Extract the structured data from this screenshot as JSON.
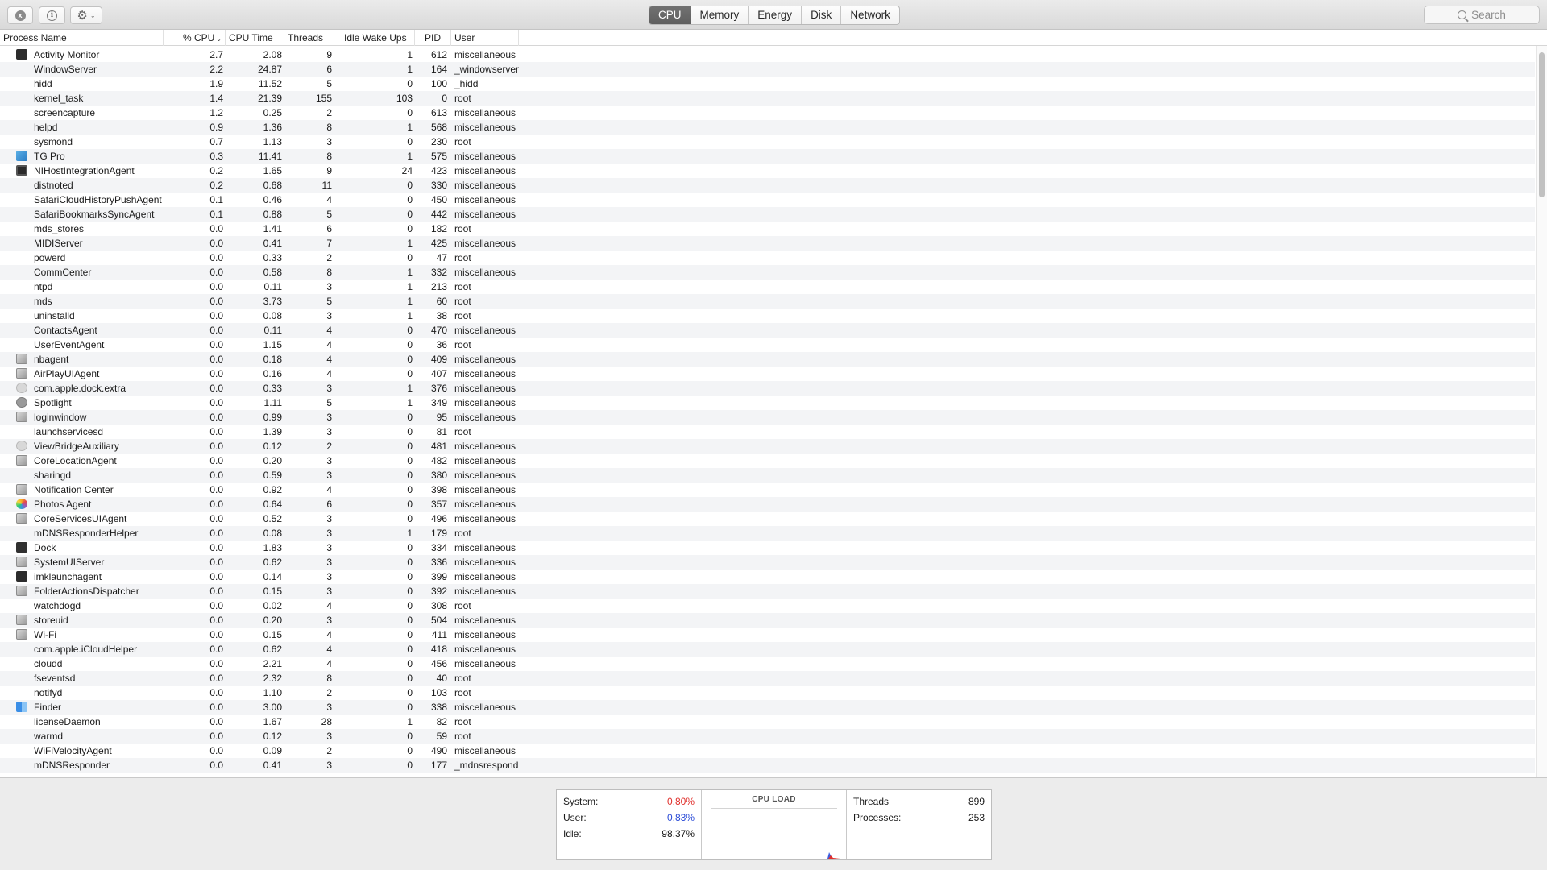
{
  "toolbar": {
    "close_icon": "x",
    "info_icon": "i",
    "gear_icon": "⚙",
    "chevron": "⌄",
    "tabs": [
      "CPU",
      "Memory",
      "Energy",
      "Disk",
      "Network"
    ],
    "active_tab": "CPU",
    "search_placeholder": "Search"
  },
  "columns": {
    "process_name": "Process Name",
    "cpu": "% CPU",
    "cpu_time": "CPU Time",
    "threads": "Threads",
    "idle_wake_ups": "Idle Wake Ups",
    "pid": "PID",
    "user": "User",
    "sort_indicator": "⌄"
  },
  "processes": [
    {
      "name": "Activity Monitor",
      "cpu": "2.7",
      "time": "2.08",
      "threads": "9",
      "idle": "1",
      "pid": "612",
      "user": "miscellaneous",
      "icon": "terminal"
    },
    {
      "name": "WindowServer",
      "cpu": "2.2",
      "time": "24.87",
      "threads": "6",
      "idle": "1",
      "pid": "164",
      "user": "_windowserver",
      "icon": ""
    },
    {
      "name": "hidd",
      "cpu": "1.9",
      "time": "11.52",
      "threads": "5",
      "idle": "0",
      "pid": "100",
      "user": "_hidd",
      "icon": ""
    },
    {
      "name": "kernel_task",
      "cpu": "1.4",
      "time": "21.39",
      "threads": "155",
      "idle": "103",
      "pid": "0",
      "user": "root",
      "icon": ""
    },
    {
      "name": "screencapture",
      "cpu": "1.2",
      "time": "0.25",
      "threads": "2",
      "idle": "0",
      "pid": "613",
      "user": "miscellaneous",
      "icon": ""
    },
    {
      "name": "helpd",
      "cpu": "0.9",
      "time": "1.36",
      "threads": "8",
      "idle": "1",
      "pid": "568",
      "user": "miscellaneous",
      "icon": ""
    },
    {
      "name": "sysmond",
      "cpu": "0.7",
      "time": "1.13",
      "threads": "3",
      "idle": "0",
      "pid": "230",
      "user": "root",
      "icon": ""
    },
    {
      "name": "TG Pro",
      "cpu": "0.3",
      "time": "11.41",
      "threads": "8",
      "idle": "1",
      "pid": "575",
      "user": "miscellaneous",
      "icon": "blue"
    },
    {
      "name": "NIHostIntegrationAgent",
      "cpu": "0.2",
      "time": "1.65",
      "threads": "9",
      "idle": "24",
      "pid": "423",
      "user": "miscellaneous",
      "icon": "ni"
    },
    {
      "name": "distnoted",
      "cpu": "0.2",
      "time": "0.68",
      "threads": "11",
      "idle": "0",
      "pid": "330",
      "user": "miscellaneous",
      "icon": ""
    },
    {
      "name": "SafariCloudHistoryPushAgent",
      "cpu": "0.1",
      "time": "0.46",
      "threads": "4",
      "idle": "0",
      "pid": "450",
      "user": "miscellaneous",
      "icon": ""
    },
    {
      "name": "SafariBookmarksSyncAgent",
      "cpu": "0.1",
      "time": "0.88",
      "threads": "5",
      "idle": "0",
      "pid": "442",
      "user": "miscellaneous",
      "icon": ""
    },
    {
      "name": "mds_stores",
      "cpu": "0.0",
      "time": "1.41",
      "threads": "6",
      "idle": "0",
      "pid": "182",
      "user": "root",
      "icon": ""
    },
    {
      "name": "MIDIServer",
      "cpu": "0.0",
      "time": "0.41",
      "threads": "7",
      "idle": "1",
      "pid": "425",
      "user": "miscellaneous",
      "icon": ""
    },
    {
      "name": "powerd",
      "cpu": "0.0",
      "time": "0.33",
      "threads": "2",
      "idle": "0",
      "pid": "47",
      "user": "root",
      "icon": ""
    },
    {
      "name": "CommCenter",
      "cpu": "0.0",
      "time": "0.58",
      "threads": "8",
      "idle": "1",
      "pid": "332",
      "user": "miscellaneous",
      "icon": ""
    },
    {
      "name": "ntpd",
      "cpu": "0.0",
      "time": "0.11",
      "threads": "3",
      "idle": "1",
      "pid": "213",
      "user": "root",
      "icon": ""
    },
    {
      "name": "mds",
      "cpu": "0.0",
      "time": "3.73",
      "threads": "5",
      "idle": "1",
      "pid": "60",
      "user": "root",
      "icon": ""
    },
    {
      "name": "uninstalld",
      "cpu": "0.0",
      "time": "0.08",
      "threads": "3",
      "idle": "1",
      "pid": "38",
      "user": "root",
      "icon": ""
    },
    {
      "name": "ContactsAgent",
      "cpu": "0.0",
      "time": "0.11",
      "threads": "4",
      "idle": "0",
      "pid": "470",
      "user": "miscellaneous",
      "icon": ""
    },
    {
      "name": "UserEventAgent",
      "cpu": "0.0",
      "time": "1.15",
      "threads": "4",
      "idle": "0",
      "pid": "36",
      "user": "root",
      "icon": ""
    },
    {
      "name": "nbagent",
      "cpu": "0.0",
      "time": "0.18",
      "threads": "4",
      "idle": "0",
      "pid": "409",
      "user": "miscellaneous",
      "icon": "gen"
    },
    {
      "name": "AirPlayUIAgent",
      "cpu": "0.0",
      "time": "0.16",
      "threads": "4",
      "idle": "0",
      "pid": "407",
      "user": "miscellaneous",
      "icon": "gen"
    },
    {
      "name": "com.apple.dock.extra",
      "cpu": "0.0",
      "time": "0.33",
      "threads": "3",
      "idle": "1",
      "pid": "376",
      "user": "miscellaneous",
      "icon": "round"
    },
    {
      "name": "Spotlight",
      "cpu": "0.0",
      "time": "1.11",
      "threads": "5",
      "idle": "1",
      "pid": "349",
      "user": "miscellaneous",
      "icon": "search"
    },
    {
      "name": "loginwindow",
      "cpu": "0.0",
      "time": "0.99",
      "threads": "3",
      "idle": "0",
      "pid": "95",
      "user": "miscellaneous",
      "icon": "gen"
    },
    {
      "name": "launchservicesd",
      "cpu": "0.0",
      "time": "1.39",
      "threads": "3",
      "idle": "0",
      "pid": "81",
      "user": "root",
      "icon": ""
    },
    {
      "name": "ViewBridgeAuxiliary",
      "cpu": "0.0",
      "time": "0.12",
      "threads": "2",
      "idle": "0",
      "pid": "481",
      "user": "miscellaneous",
      "icon": "round"
    },
    {
      "name": "CoreLocationAgent",
      "cpu": "0.0",
      "time": "0.20",
      "threads": "3",
      "idle": "0",
      "pid": "482",
      "user": "miscellaneous",
      "icon": "gen"
    },
    {
      "name": "sharingd",
      "cpu": "0.0",
      "time": "0.59",
      "threads": "3",
      "idle": "0",
      "pid": "380",
      "user": "miscellaneous",
      "icon": ""
    },
    {
      "name": "Notification Center",
      "cpu": "0.0",
      "time": "0.92",
      "threads": "4",
      "idle": "0",
      "pid": "398",
      "user": "miscellaneous",
      "icon": "gen"
    },
    {
      "name": "Photos Agent",
      "cpu": "0.0",
      "time": "0.64",
      "threads": "6",
      "idle": "0",
      "pid": "357",
      "user": "miscellaneous",
      "icon": "photos"
    },
    {
      "name": "CoreServicesUIAgent",
      "cpu": "0.0",
      "time": "0.52",
      "threads": "3",
      "idle": "0",
      "pid": "496",
      "user": "miscellaneous",
      "icon": "gen"
    },
    {
      "name": "mDNSResponderHelper",
      "cpu": "0.0",
      "time": "0.08",
      "threads": "3",
      "idle": "1",
      "pid": "179",
      "user": "root",
      "icon": ""
    },
    {
      "name": "Dock",
      "cpu": "0.0",
      "time": "1.83",
      "threads": "3",
      "idle": "0",
      "pid": "334",
      "user": "miscellaneous",
      "icon": "dock"
    },
    {
      "name": "SystemUIServer",
      "cpu": "0.0",
      "time": "0.62",
      "threads": "3",
      "idle": "0",
      "pid": "336",
      "user": "miscellaneous",
      "icon": "gen"
    },
    {
      "name": "imklaunchagent",
      "cpu": "0.0",
      "time": "0.14",
      "threads": "3",
      "idle": "0",
      "pid": "399",
      "user": "miscellaneous",
      "icon": "terminal"
    },
    {
      "name": "FolderActionsDispatcher",
      "cpu": "0.0",
      "time": "0.15",
      "threads": "3",
      "idle": "0",
      "pid": "392",
      "user": "miscellaneous",
      "icon": "gen"
    },
    {
      "name": "watchdogd",
      "cpu": "0.0",
      "time": "0.02",
      "threads": "4",
      "idle": "0",
      "pid": "308",
      "user": "root",
      "icon": ""
    },
    {
      "name": "storeuid",
      "cpu": "0.0",
      "time": "0.20",
      "threads": "3",
      "idle": "0",
      "pid": "504",
      "user": "miscellaneous",
      "icon": "gen"
    },
    {
      "name": "Wi-Fi",
      "cpu": "0.0",
      "time": "0.15",
      "threads": "4",
      "idle": "0",
      "pid": "411",
      "user": "miscellaneous",
      "icon": "gen"
    },
    {
      "name": "com.apple.iCloudHelper",
      "cpu": "0.0",
      "time": "0.62",
      "threads": "4",
      "idle": "0",
      "pid": "418",
      "user": "miscellaneous",
      "icon": ""
    },
    {
      "name": "cloudd",
      "cpu": "0.0",
      "time": "2.21",
      "threads": "4",
      "idle": "0",
      "pid": "456",
      "user": "miscellaneous",
      "icon": ""
    },
    {
      "name": "fseventsd",
      "cpu": "0.0",
      "time": "2.32",
      "threads": "8",
      "idle": "0",
      "pid": "40",
      "user": "root",
      "icon": ""
    },
    {
      "name": "notifyd",
      "cpu": "0.0",
      "time": "1.10",
      "threads": "2",
      "idle": "0",
      "pid": "103",
      "user": "root",
      "icon": ""
    },
    {
      "name": "Finder",
      "cpu": "0.0",
      "time": "3.00",
      "threads": "3",
      "idle": "0",
      "pid": "338",
      "user": "miscellaneous",
      "icon": "finder"
    },
    {
      "name": "licenseDaemon",
      "cpu": "0.0",
      "time": "1.67",
      "threads": "28",
      "idle": "1",
      "pid": "82",
      "user": "root",
      "icon": ""
    },
    {
      "name": "warmd",
      "cpu": "0.0",
      "time": "0.12",
      "threads": "3",
      "idle": "0",
      "pid": "59",
      "user": "root",
      "icon": ""
    },
    {
      "name": "WiFiVelocityAgent",
      "cpu": "0.0",
      "time": "0.09",
      "threads": "2",
      "idle": "0",
      "pid": "490",
      "user": "miscellaneous",
      "icon": ""
    },
    {
      "name": "mDNSResponder",
      "cpu": "0.0",
      "time": "0.41",
      "threads": "3",
      "idle": "0",
      "pid": "177",
      "user": "_mdnsrespond",
      "icon": ""
    }
  ],
  "summary": {
    "system_label": "System:",
    "system_value": "0.80%",
    "user_label": "User:",
    "user_value": "0.83%",
    "idle_label": "Idle:",
    "idle_value": "98.37%",
    "load_title": "CPU LOAD",
    "threads_label": "Threads",
    "threads_value": "899",
    "processes_label": "Processes:",
    "processes_value": "253"
  },
  "colors": {
    "system_red": "#e0302c",
    "user_blue": "#2a4bd7",
    "active_tab": "#666666"
  }
}
